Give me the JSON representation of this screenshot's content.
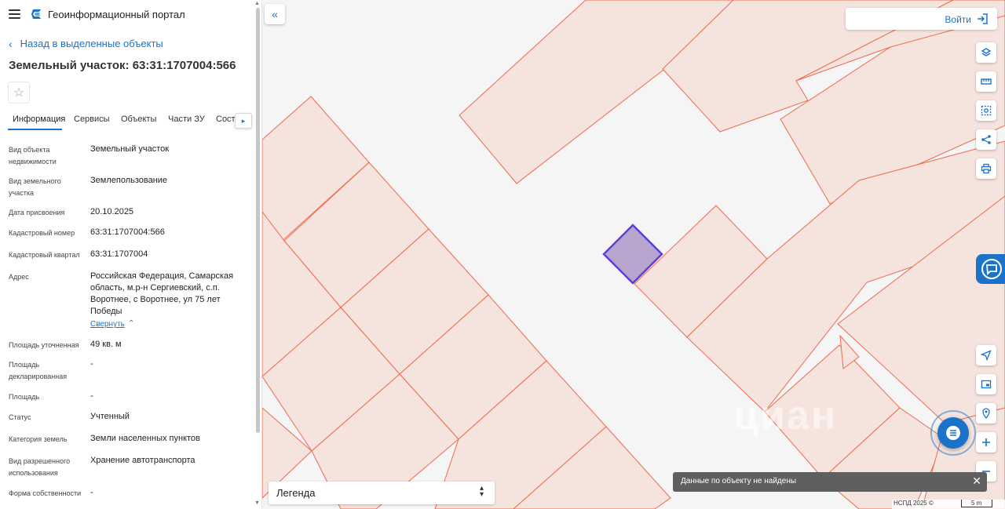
{
  "app": {
    "title": "Геоинформационный портал"
  },
  "nav": {
    "back_label": "Назад в выделенные объекты"
  },
  "object": {
    "title": "Земельный участок: 63:31:1707004:566"
  },
  "tabs": [
    {
      "label": "Информация",
      "active": true
    },
    {
      "label": "Сервисы"
    },
    {
      "label": "Объекты"
    },
    {
      "label": "Части ЗУ"
    },
    {
      "label": "Соста"
    }
  ],
  "info": {
    "fields": [
      {
        "label": "Вид объекта недвижимости",
        "value": "Земельный участок"
      },
      {
        "label": "Вид земельного участка",
        "value": "Землепользование"
      },
      {
        "label": "Дата присвоения",
        "value": "20.10.2025"
      },
      {
        "label": "Кадастровый номер",
        "value": "63:31:1707004:566"
      },
      {
        "label": "Кадастровый квартал",
        "value": "63:31:1707004"
      },
      {
        "label": "Адрес",
        "value": "Российская Федерация, Самарская область, м.р-н Сергиевский, с.п. Воротнее, с Воротнее, ул 75 лет Победы"
      },
      {
        "label": "Площадь уточненная",
        "value": "49 кв. м"
      },
      {
        "label": "Площадь декларированная",
        "value": "-"
      },
      {
        "label": "Площадь",
        "value": "-"
      },
      {
        "label": "Статус",
        "value": "Учтенный"
      },
      {
        "label": "Категория земель",
        "value": "Земли населенных пунктов"
      },
      {
        "label": "Вид разрешенного использования",
        "value": "Хранение автотранспорта"
      },
      {
        "label": "Форма собственности",
        "value": "-"
      }
    ],
    "collapse_label": "Свернуть"
  },
  "map": {
    "login_label": "Войти",
    "legend_label": "Легенда",
    "toast_text": "Данные по объекту не найдены",
    "copyright": "НСПД 2025 ©",
    "scale_label": "5 m",
    "watermark": "циан",
    "tools": [
      "layers-icon",
      "ruler-icon",
      "area-select-icon",
      "share-icon",
      "print-icon"
    ],
    "bottom_tools": [
      "locate-icon",
      "picture-in-picture-icon",
      "pin-icon",
      "zoom-in-icon"
    ]
  },
  "colors": {
    "accent": "#1a73c8",
    "parcel_fill": "#f5e3de",
    "parcel_stroke": "#ef6a4c",
    "selected_fill": "#b7a5cf",
    "selected_stroke": "#5b3fd6",
    "map_bg": "#f5f5f5"
  }
}
